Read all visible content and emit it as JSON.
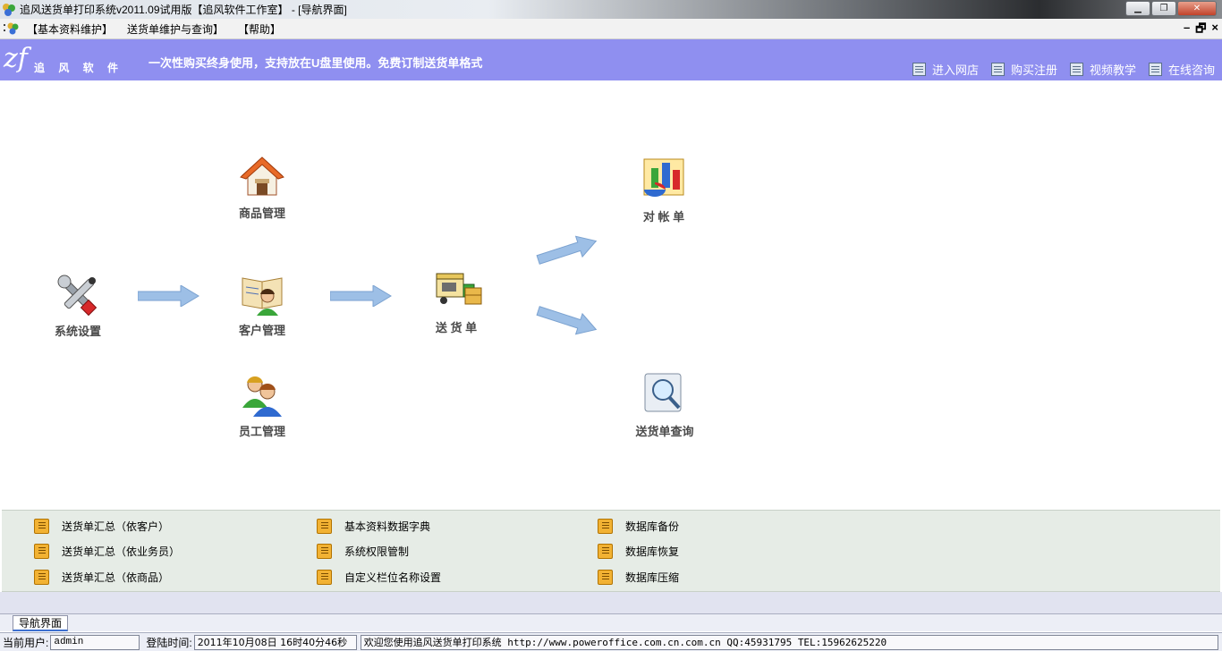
{
  "window": {
    "title": "追风送货单打印系统v2011.09试用版【追风软件工作室】 - [导航界面]"
  },
  "menu": {
    "items": [
      "【基本资料维护】",
      "送货单维护与查询】",
      "【帮助】"
    ]
  },
  "header": {
    "logo_text": "追 风 软 件",
    "slogan": "一次性购买终身使用，支持放在U盘里使用。免费订制送货单格式",
    "links": [
      "进入网店",
      "购买注册",
      "视频教学",
      "在线咨询"
    ]
  },
  "nav": {
    "system_settings": "系统设置",
    "goods_mgmt": "商品管理",
    "customer_mgmt": "客户管理",
    "staff_mgmt": "员工管理",
    "delivery_note": "送 货 单",
    "statement": "对 帐 单",
    "delivery_query": "送货单查询"
  },
  "quick_links": {
    "col1": [
      "送货单汇总（依客户）",
      "送货单汇总（依业务员）",
      "送货单汇总（依商品）"
    ],
    "col2": [
      "基本资料数据字典",
      "系统权限管制",
      "自定义栏位名称设置"
    ],
    "col3": [
      "数据库备份",
      "数据库恢复",
      "数据库压缩"
    ]
  },
  "tabs": [
    "导航界面"
  ],
  "status": {
    "user_label": "当前用户:",
    "user_value": "admin",
    "login_label": "登陆时间:",
    "login_value": "2011年10月08日 16时40分46秒",
    "welcome": "欢迎您使用追风送货单打印系统 http://www.poweroffice.com.cn.com.cn QQ:45931795 TEL:15962625220"
  },
  "colors": {
    "header_band": "#8f8ff0",
    "arrow_fill": "#9dbfe6",
    "quick_panel": "#e6ece6"
  }
}
